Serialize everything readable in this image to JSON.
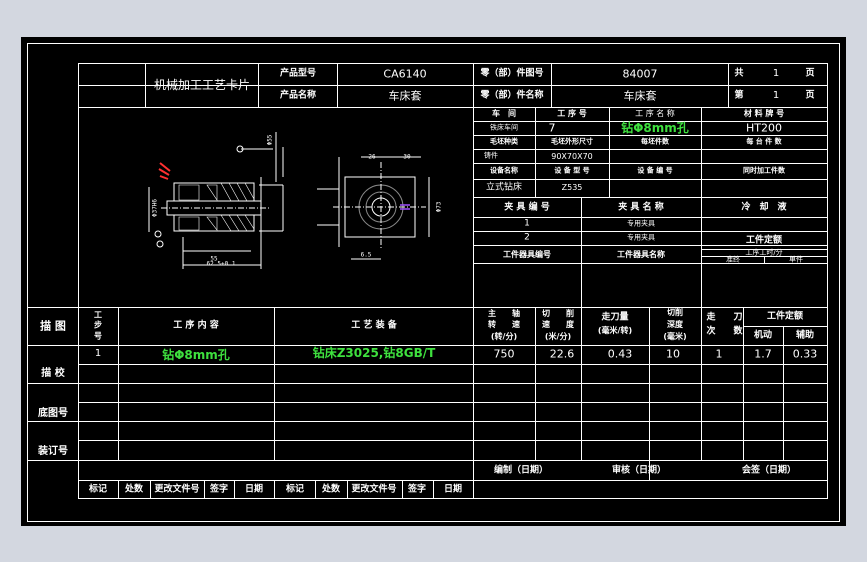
{
  "card_title": "机械加工工艺卡片",
  "header": {
    "product_model_label": "产品型号",
    "product_model": "CA6140",
    "product_name_label": "产品名称",
    "product_name": "车床套",
    "part_no_label": "零（部）件图号",
    "part_no": "84007",
    "part_name_label": "零（部）件名称",
    "part_name": "车床套",
    "total_label": "共",
    "total_value": "1",
    "page_unit": "页",
    "page_label": "第",
    "page_value": "1",
    "page_unit2": "页"
  },
  "info": {
    "workshop_label": "车　间",
    "process_no_label": "工 序 号",
    "process_name_label": "工 序 名 称",
    "material_label": "材 料 牌 号",
    "workshop": "铁床车间",
    "process_no": "7",
    "process_name": "钻Φ8mm孔",
    "material": "HT200",
    "blank_type_label": "毛坯种类",
    "blank_size_label": "毛坯外形尺寸",
    "blank_count_label": "每坯件数",
    "per_machine_label": "每 台 件 数",
    "blank_type": "铸件",
    "blank_size": "90X70X70",
    "equip_name_label": "设备名称",
    "equip_model_label": "设 备 型 号",
    "equip_no_label": "设 备 编 号",
    "simul_label": "同时加工件数",
    "equip_name": "立式钻床",
    "equip_model": "Z535",
    "fixture_no_label": "夹 具 编 号",
    "fixture_name_label": "夹 具 名 称",
    "coolant_label": "冷　却　液",
    "fixture_row1_no": "1",
    "fixture_row1_name": "专用夹具",
    "fixture_row2_no": "2",
    "fixture_row2_name": "专用夹具",
    "work_quota_label": "工件定额",
    "tool_no_label": "工件器具编号",
    "tool_name_label": "工件器具名称",
    "prep_time_label": "工序工时/分",
    "prep_sub1": "准终",
    "prep_sub2": "单件"
  },
  "drawing_dims": {
    "d_left_bottom": "55",
    "d_left_total": "62.5±0.1",
    "d_right_top_a": "26",
    "d_right_top_b": "30",
    "d_right_bottom": "6.5",
    "d_right_side": "Φ73",
    "d_left_side": "Φ37H6",
    "d_top": "Φ55"
  },
  "side_labels": {
    "describe": "描 图",
    "check": "描 校",
    "base_no": "底图号",
    "binding_no": "装订号"
  },
  "ops_header": {
    "step_no": "工\n步\n号",
    "content": "工 序 内 容",
    "equipment": "工 艺 装 备",
    "spindle": "主\n轴\n转\n速\n(转/分)",
    "spindle_a": "主　　轴",
    "spindle_b": "转　　速",
    "spindle_c": "(转/分)",
    "cut_a": "切　　削",
    "cut_b": "速　　度",
    "cut_c": "(米/分)",
    "feed_a": "走刀量",
    "feed_b": "(毫米/转)",
    "depth_a": "切削",
    "depth_b": "深度",
    "depth_c": "(毫米)",
    "passes_a": "走",
    "passes_b": "次",
    "passes_c": "刀",
    "passes_d": "数",
    "quota": "工件定额",
    "machine_time": "机动",
    "aux_time": "辅助"
  },
  "operations": [
    {
      "step": "1",
      "content": "钻Φ8mm孔",
      "equipment": "钻床Z3025,钻8GB/T",
      "spindle_speed": "750",
      "cut_speed": "22.6",
      "feed": "0.43",
      "depth": "10",
      "passes": "1",
      "machine_time": "1.7",
      "aux_time": "0.33"
    }
  ],
  "footer": {
    "compiled": "编制（日期）",
    "reviewed": "审核（日期）",
    "signed": "会签（日期）",
    "mark": "标记",
    "count": "处数",
    "change_doc": "更改文件号",
    "sign": "签字",
    "date": "日期",
    "mark2": "标记",
    "count2": "处数",
    "change_doc2": "更改文件号",
    "sign2": "签字",
    "date2": "日期"
  },
  "colors": {
    "background": "#d3d7e0",
    "sheet": "#000000",
    "lines": "#ffffff",
    "highlight": "#3ee03e",
    "marker": "#ff3030"
  }
}
